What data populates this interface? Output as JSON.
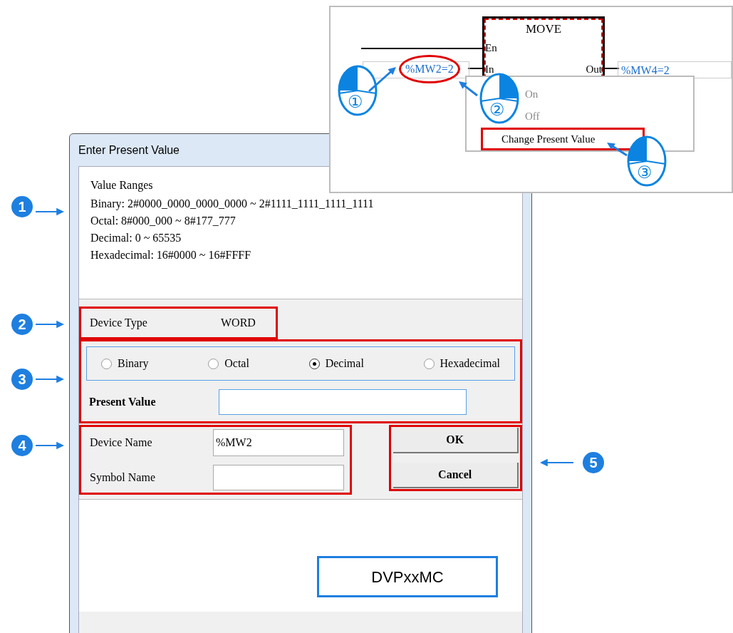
{
  "inset": {
    "block_title": "MOVE",
    "pin_en": "En",
    "pin_in": "In",
    "pin_out": "Out",
    "input_value": "%MW2=2",
    "output_value": "%MW4=2",
    "menu": [
      {
        "label": "On",
        "disabled": true,
        "highlighted": false
      },
      {
        "label": "Off",
        "disabled": true,
        "highlighted": false
      },
      {
        "label": "Change Present Value",
        "disabled": false,
        "highlighted": true
      }
    ],
    "steps": [
      {
        "number": "①",
        "kind": "left"
      },
      {
        "number": "②",
        "kind": "right"
      },
      {
        "number": "③",
        "kind": "left"
      }
    ]
  },
  "dialog": {
    "title": "Enter Present Value",
    "ranges_heading": "Value Ranges",
    "ranges": [
      "Binary: 2#0000_0000_0000_0000 ~ 2#1111_1111_1111_1111",
      "Octal: 8#000_000 ~ 8#177_777",
      "Decimal: 0 ~ 65535",
      "Hexadecimal: 16#0000 ~ 16#FFFF"
    ],
    "device_type": {
      "label": "Device Type",
      "value": "WORD"
    },
    "formats": [
      {
        "label": "Binary",
        "selected": false
      },
      {
        "label": "Octal",
        "selected": false
      },
      {
        "label": "Decimal",
        "selected": true
      },
      {
        "label": "Hexadecimal",
        "selected": false
      }
    ],
    "present_value": {
      "label": "Present Value"
    },
    "device_name": {
      "label": "Device Name",
      "value": "%MW2"
    },
    "symbol_name": {
      "label": "Symbol Name"
    },
    "buttons": [
      "OK",
      "Cancel"
    ],
    "model_label": "DVPxxMC"
  },
  "callouts": [
    "1",
    "2",
    "3",
    "4",
    "5"
  ]
}
